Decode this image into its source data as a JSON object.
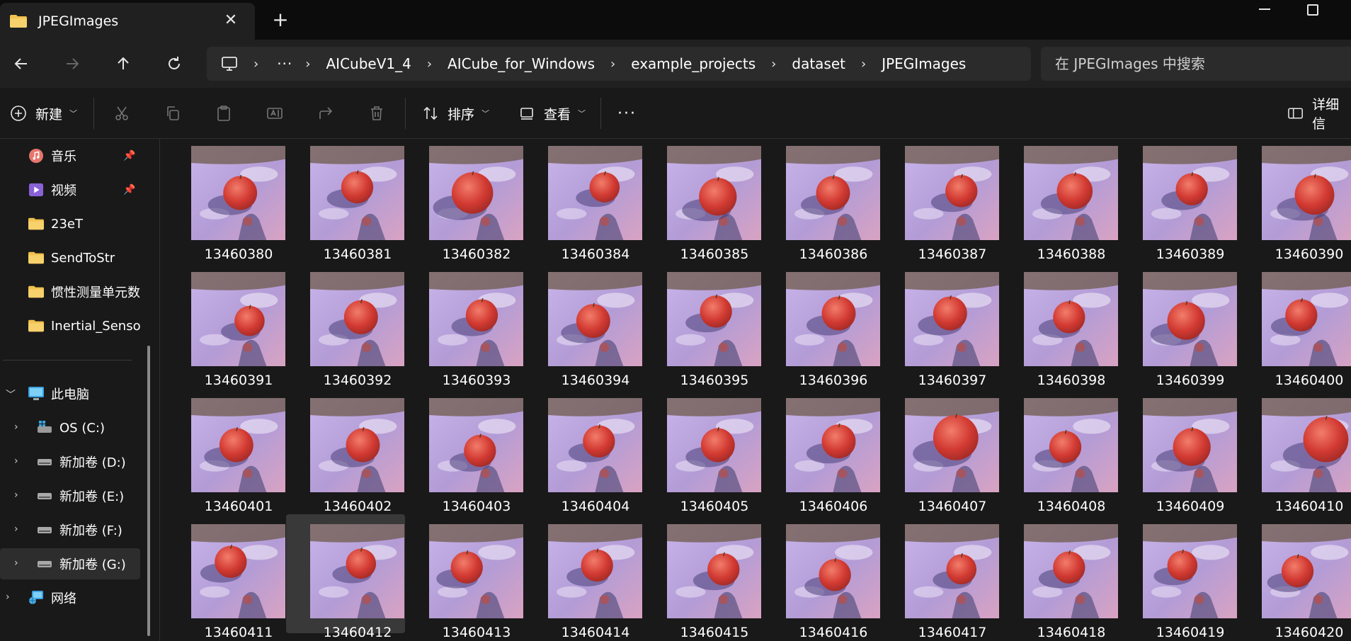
{
  "tab": {
    "title": "JPEGImages",
    "close": "✕"
  },
  "new_tab": "+",
  "breadcrumb": {
    "ellipsis": "···",
    "items": [
      "AICubeV1_4",
      "AICube_for_Windows",
      "example_projects",
      "dataset",
      "JPEGImages"
    ]
  },
  "search": {
    "placeholder": "在 JPEGImages 中搜索"
  },
  "commands": {
    "new": "新建",
    "sort": "排序",
    "view": "查看",
    "more": "···",
    "details": "详细信"
  },
  "sidebar": {
    "pinned": [
      {
        "label": "音乐",
        "icon": "music-icon"
      },
      {
        "label": "视频",
        "icon": "video-icon"
      },
      {
        "label": "23eT",
        "icon": "folder-icon"
      },
      {
        "label": "SendToStr",
        "icon": "folder-icon"
      },
      {
        "label": "惯性测量单元数",
        "icon": "folder-icon"
      },
      {
        "label": "Inertial_Sensor",
        "icon": "folder-icon"
      }
    ],
    "this_pc": "此电脑",
    "drives": [
      {
        "label": "OS (C:)"
      },
      {
        "label": "新加卷 (D:)"
      },
      {
        "label": "新加卷 (E:)"
      },
      {
        "label": "新加卷 (F:)"
      },
      {
        "label": "新加卷 (G:)"
      }
    ],
    "network": "网络"
  },
  "files": [
    "13460380",
    "13460381",
    "13460382",
    "13460384",
    "13460385",
    "13460386",
    "13460387",
    "13460388",
    "13460389",
    "13460390",
    "13460391",
    "13460392",
    "13460393",
    "13460394",
    "13460395",
    "13460396",
    "13460397",
    "13460398",
    "13460399",
    "13460400",
    "13460401",
    "13460402",
    "13460403",
    "13460404",
    "13460405",
    "13460406",
    "13460407",
    "13460408",
    "13460409",
    "13460410",
    "13460411",
    "13460412",
    "13460413",
    "13460414",
    "13460415",
    "13460416",
    "13460417",
    "13460418",
    "13460419",
    "13460420"
  ],
  "selected_file": "13460412",
  "colors": {
    "accent_folder": "#f2c14e",
    "background": "#191919",
    "address_bg": "#2b2b2b",
    "apple_red": "#d23a32",
    "table_lilac": "#b9a2d8"
  }
}
